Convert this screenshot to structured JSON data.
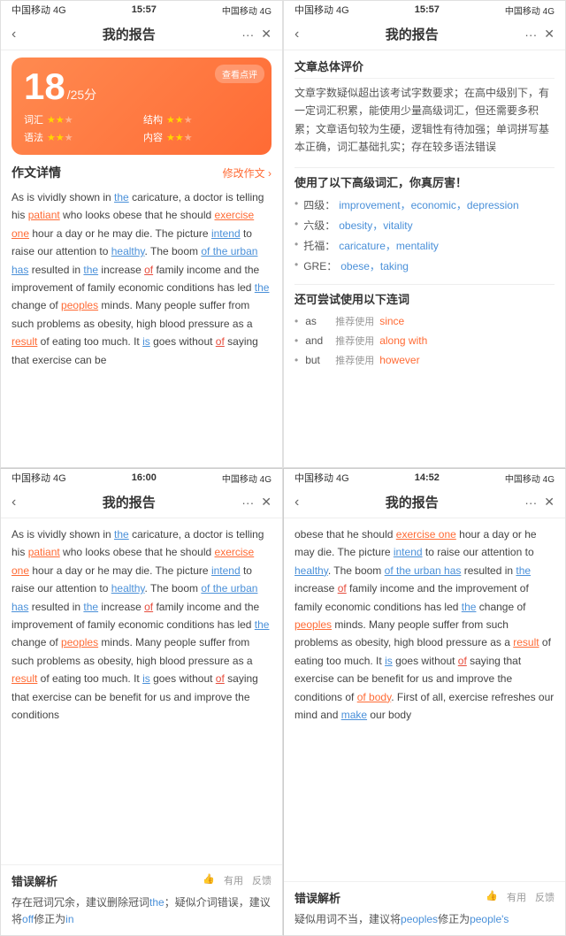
{
  "screens": [
    {
      "id": "screen1",
      "statusBar": {
        "left": "中国移动 4G",
        "center": "15:57",
        "right": "中国移动 4G"
      },
      "navTitle": "我的报告",
      "scoreCard": {
        "reviewLabel": "查看点评",
        "score": "18",
        "total": "/25分",
        "metrics": [
          {
            "label": "词汇",
            "stars": 2,
            "max": 3
          },
          {
            "label": "结构",
            "stars": 2,
            "max": 3
          },
          {
            "label": "语法",
            "stars": 2,
            "max": 3
          },
          {
            "label": "内容",
            "stars": 2,
            "max": 3
          }
        ]
      },
      "essaySection": {
        "title": "作文详情",
        "editLabel": "修改作文 ›"
      },
      "essayText": "As is vividly shown in the caricature, a doctor is telling his patiant who looks obese that he should exercise one hour a day or he may die. The picture intend to raise our attention to healthy. The boom of the urban has resulted in the increase of family income and the improvement of family economic conditions has led the change of peoples minds. Many people suffer from such problems as obesity, high blood pressure as a result of eating too much. It is goes without of saying that exercise can be"
    },
    {
      "id": "screen2",
      "statusBar": {
        "left": "中国移动 4G",
        "center": "15:57",
        "right": "中国移动 4G"
      },
      "navTitle": "我的报告",
      "reviewTitle": "文章总体评价",
      "reviewText": "文章字数疑似超出该考试字数要求；在高中级别下，有一定词汇积累，能使用少量高级词汇，但还需要多积累；文章语句较为生硬，逻辑性有待加强；单词拼写基本正确，词汇基础扎实；存在较多语法错误",
      "vocabTitle": "使用了以下高级词汇，你真厉害！",
      "vocabItems": [
        {
          "level": "四级：",
          "words": "improvement，economic，depression"
        },
        {
          "level": "六级：",
          "words": "obesity，vitality"
        },
        {
          "level": "托福：",
          "words": "caricature，mentality"
        },
        {
          "level": "GRE：",
          "words": "obese，taking"
        }
      ],
      "connectorTitle": "还可尝试使用以下连词",
      "connectorItems": [
        {
          "word": "as",
          "recommend": "推荐使用",
          "suggestion": "since"
        },
        {
          "word": "and",
          "recommend": "推荐使用",
          "suggestion": "along with"
        },
        {
          "word": "but",
          "recommend": "推荐使用",
          "suggestion": "however"
        }
      ]
    },
    {
      "id": "screen3",
      "statusBar": {
        "left": "中国移动 4G",
        "center": "16:00",
        "right": "中国移动 4G"
      },
      "navTitle": "我的报告",
      "essayText": "As is vividly shown in the caricature, a doctor is telling his patiant who looks obese that he should exercise one hour a day or he may die. The picture intend to raise our attention to healthy. The boom of the urban has resulted in the increase of family income and the improvement of family economic conditions has led the change of peoples minds. Many people suffer from such problems as obesity, high blood pressure as a result of eating too much. It is goes without of saying that exercise can be benefit for us and improve the conditions",
      "errorSection": {
        "title": "错误解析",
        "useful": "有用",
        "feedback": "反馈",
        "text": "存在冠词冗余，建议删除冠词the；疑似介词错误，建议将off修正为in"
      }
    },
    {
      "id": "screen4",
      "statusBar": {
        "left": "中国移动 4G",
        "center": "14:52",
        "right": "中国移动 4G"
      },
      "navTitle": "我的报告",
      "essayText": "obese that he should exercise one hour a day or he may die. The picture intend to raise our attention to healthy. The boom of the urban has resulted in the increase of family income and the improvement of family economic conditions has led the change of peoples minds. Many people suffer from such problems as obesity, high blood pressure as a result of eating too much. It is goes without of saying that exercise can be benefit for us and improve the conditions of body. First of all, exercise refreshes our mind and make our body",
      "errorSection": {
        "title": "错误解析",
        "useful": "有用",
        "feedback": "反馈",
        "text": "疑似用词不当，建议将peoples修正为people's"
      }
    }
  ]
}
